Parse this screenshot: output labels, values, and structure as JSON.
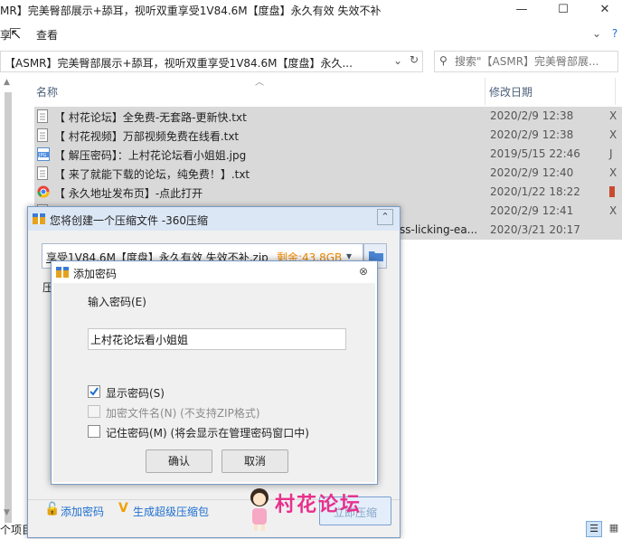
{
  "explorer": {
    "title": "MR】完美臀部展示+舔耳，视听双重享受1V84.6M【度盘】永久有效 失效不补",
    "window_buttons": {
      "minimize": "—",
      "maximize": "☐",
      "close": "✕"
    },
    "menu": {
      "share": "享",
      "view": "查看"
    },
    "address": "【ASMR】完美臀部展示+舔耳，视听双重享受1V84.6M【度盘】永久...",
    "search_placeholder": "搜索\"【ASMR】完美臀部展...",
    "columns": {
      "name": "名称",
      "date": "修改日期"
    },
    "files": [
      {
        "name": "【 村花论坛】全免费-无套路-更新快.txt",
        "date": "2020/2/9 12:38",
        "icon": "txt-file-icon"
      },
      {
        "name": "【 村花视频】万部视频免费在线看.txt",
        "date": "2020/2/9 12:38",
        "icon": "txt-file-icon"
      },
      {
        "name": "【 解压密码】：上村花论坛看小姐姐.jpg",
        "date": "2019/5/15 22:46",
        "icon": "jpg-file-icon"
      },
      {
        "name": "【 来了就能下载的论坛，纯免费！】.txt",
        "date": "2020/2/9 12:40",
        "icon": "txt-file-icon"
      },
      {
        "name": "【 永久地址发布页】-点此打开",
        "date": "2020/1/22 18:22",
        "icon": "chrome-shortcut-icon"
      },
      {
        "name": "",
        "date": "2020/2/9 12:41",
        "icon": "txt-file-icon"
      },
      {
        "name": "ss-licking-ea...",
        "date": "2020/3/21 20:17",
        "icon": "none"
      }
    ],
    "status_left": "个项目"
  },
  "zip_dialog": {
    "title": "您将创建一个压缩文件 -360压缩",
    "path": "享受1V84.6M【度盘】永久有效 失效不补.zip",
    "free_space": "剩余:43.8GB",
    "label_compress": "压",
    "add_password": "添加密码",
    "super_package": "生成超级压缩包",
    "ok_button": "立即压缩"
  },
  "password_dialog": {
    "title": "添加密码",
    "input_label": "输入密码(E)",
    "password_value": "上村花论坛看小姐姐",
    "show_password": {
      "label": "显示密码(S)",
      "checked": true
    },
    "encrypt_names": {
      "label": "加密文件名(N) (不支持ZIP格式)",
      "checked": false
    },
    "remember_password": {
      "label": "记住密码(M) (将会显示在管理密码窗口中)",
      "checked": false
    },
    "confirm": "确认",
    "cancel": "取消"
  },
  "watermark": {
    "text": "村花论坛",
    "color": "#e8308c"
  },
  "colors": {
    "selection": "#d9d9d9",
    "dialog_bg": "#f0f0f0",
    "accent_blue": "#1e6fd0",
    "free_space": "#f08a00"
  }
}
